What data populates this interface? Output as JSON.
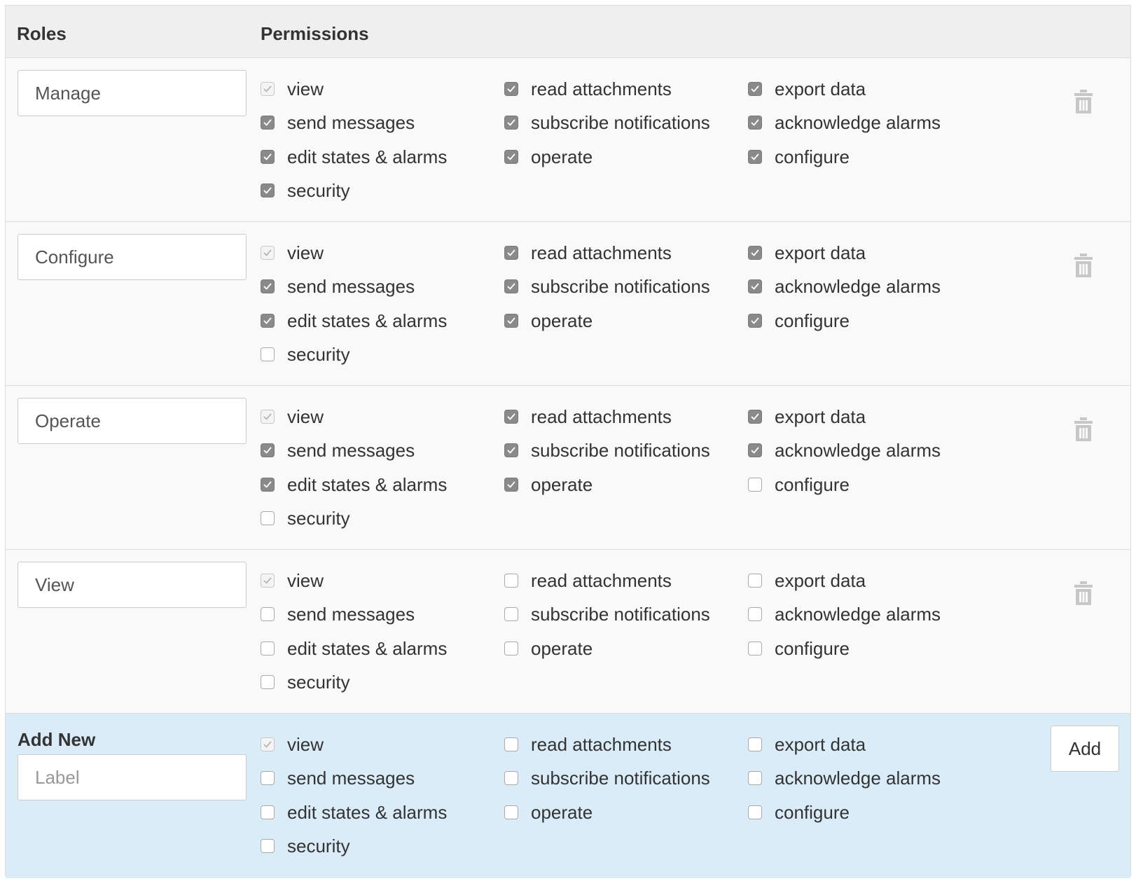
{
  "header": {
    "roles_label": "Roles",
    "permissions_label": "Permissions"
  },
  "permission_labels": [
    "view",
    "read attachments",
    "export data",
    "send messages",
    "subscribe notifications",
    "acknowledge alarms",
    "edit states & alarms",
    "operate",
    "configure",
    "security"
  ],
  "roles": [
    {
      "label": "Manage",
      "checked": [
        "view",
        "read attachments",
        "export data",
        "send messages",
        "subscribe notifications",
        "acknowledge alarms",
        "edit states & alarms",
        "operate",
        "configure",
        "security"
      ]
    },
    {
      "label": "Configure",
      "checked": [
        "view",
        "read attachments",
        "export data",
        "send messages",
        "subscribe notifications",
        "acknowledge alarms",
        "edit states & alarms",
        "operate",
        "configure"
      ]
    },
    {
      "label": "Operate",
      "checked": [
        "view",
        "read attachments",
        "export data",
        "send messages",
        "subscribe notifications",
        "acknowledge alarms",
        "edit states & alarms",
        "operate"
      ]
    },
    {
      "label": "View",
      "checked": [
        "view"
      ]
    }
  ],
  "always_on_permission": "view",
  "add_new": {
    "title": "Add New",
    "placeholder": "Label",
    "button_label": "Add",
    "checked": [
      "view"
    ]
  },
  "icons": {
    "delete": "trash-icon",
    "check": "checkmark-icon"
  },
  "colors": {
    "add_row_bg": "#d9ecf7",
    "checked_box": "#8a8a8a",
    "header_bg": "#efefef"
  }
}
